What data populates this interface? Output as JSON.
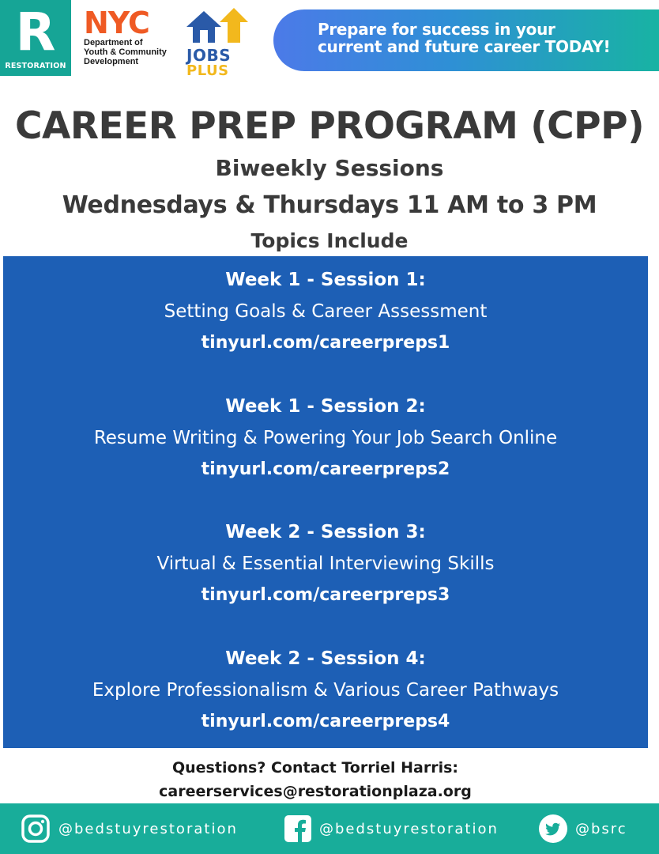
{
  "header": {
    "restoration_logo": {
      "letter": "R",
      "word": "RESTORATION"
    },
    "nyc_logo": {
      "word": "NYC",
      "lines": [
        "Department of",
        "Youth & Community",
        "Development"
      ]
    },
    "jobsplus_logo": {
      "jobs": "JOBS",
      "plus": "PLUS"
    },
    "banner": {
      "line1": "Prepare for success in your",
      "line2": "current and future career TODAY!"
    }
  },
  "main": {
    "title": "CAREER PREP PROGRAM (CPP)",
    "subtitle1": "Biweekly Sessions",
    "subtitle2": "Wednesdays & Thursdays 11 AM to 3 PM",
    "subtitle3": "Topics Include"
  },
  "sessions": [
    {
      "heading": "Week 1 - Session 1:",
      "topic": "Setting Goals & Career Assessment",
      "link": "tinyurl.com/careerpreps1"
    },
    {
      "heading": "Week 1 - Session 2:",
      "topic": "Resume Writing & Powering Your Job Search Online",
      "link": "tinyurl.com/careerpreps2"
    },
    {
      "heading": "Week 2 - Session 3:",
      "topic": "Virtual & Essential Interviewing Skills",
      "link": "tinyurl.com/careerpreps3"
    },
    {
      "heading": "Week 2 - Session 4:",
      "topic": "Explore Professionalism & Various Career Pathways",
      "link": "tinyurl.com/careerpreps4"
    }
  ],
  "contact": {
    "line1": "Questions? Contact Torriel Harris:",
    "email": "careerservices@restorationplaza.org"
  },
  "footer": {
    "instagram": {
      "icon": "instagram-icon",
      "handle": "@bedstuyrestoration"
    },
    "facebook": {
      "icon": "facebook-icon",
      "handle": "@bedstuyrestoration"
    },
    "twitter": {
      "icon": "twitter-icon",
      "handle": "@bsrc"
    }
  },
  "colors": {
    "teal": "#18ad9a",
    "session_blue": "#1d5fb5",
    "nyc_orange": "#ef5a24",
    "jobs_blue": "#2a5aa8",
    "plus_yellow": "#f2b81d",
    "text_dark": "#3a3a3a"
  }
}
